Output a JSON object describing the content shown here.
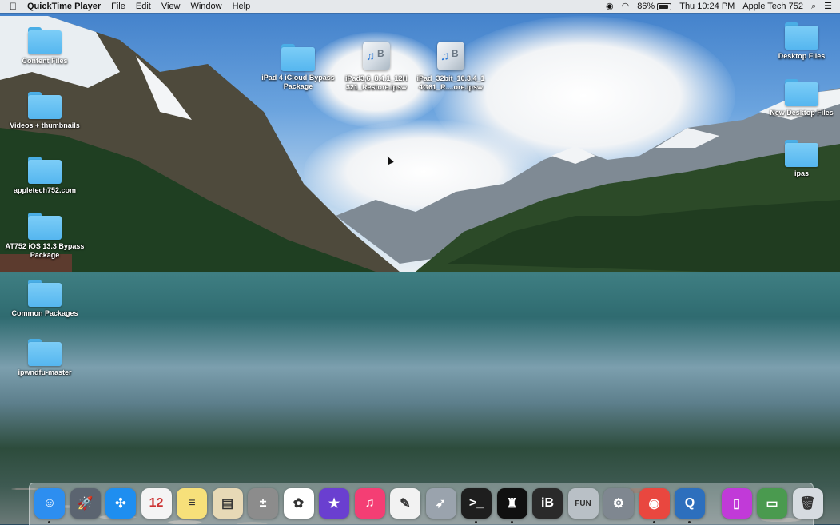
{
  "menubar": {
    "app_name": "QuickTime Player",
    "menus": [
      "File",
      "Edit",
      "View",
      "Window",
      "Help"
    ],
    "battery_percent_label": "86%",
    "battery_level": 0.86,
    "clock": "Thu 10:24 PM",
    "user": "Apple Tech 752",
    "icons": [
      "apple-icon",
      "screen-record-icon",
      "wifi-icon",
      "battery-charging-icon",
      "spotlight-icon",
      "notification-center-icon"
    ]
  },
  "desktop": {
    "left_icons": [
      "Content Files",
      "Videos + thumbnails",
      "appletech752.com",
      "AT752 iOS 13.3 Bypass Package",
      "Common Packages",
      "ipwndfu-master"
    ],
    "center_icons": [
      "iPad 4 iCloud Bypass Package",
      "iPad3,6_8.4.1_12H321_Restore.ipsw",
      "iPad_32bit_10.3.4_14G61_R....ore.ipsw"
    ],
    "right_icons": [
      "Desktop Files",
      "New Desktop Files",
      "ipas"
    ]
  },
  "dock": {
    "items": [
      {
        "name": "finder-icon",
        "glyph": "☺",
        "color": "#2d8ef0"
      },
      {
        "name": "launchpad-icon",
        "glyph": "🚀",
        "color": "#5b6470"
      },
      {
        "name": "safari-icon",
        "glyph": "✣",
        "color": "#1e8ef0"
      },
      {
        "name": "calendar-icon",
        "glyph": "12",
        "color": "#f4f4f4"
      },
      {
        "name": "notes-icon",
        "glyph": "≡",
        "color": "#f7e07a"
      },
      {
        "name": "preview-icon",
        "glyph": "▤",
        "color": "#e7d9b6"
      },
      {
        "name": "calculator-icon",
        "glyph": "±",
        "color": "#8c8c8c"
      },
      {
        "name": "photos-icon",
        "glyph": "✿",
        "color": "#ffffff"
      },
      {
        "name": "imovie-icon",
        "glyph": "★",
        "color": "#6a3fd0"
      },
      {
        "name": "itunes-icon",
        "glyph": "♫",
        "color": "#f43e74"
      },
      {
        "name": "textedit-icon",
        "glyph": "✎",
        "color": "#f2f2f2"
      },
      {
        "name": "rocket-app-icon",
        "glyph": "➶",
        "color": "#9aa3ad"
      },
      {
        "name": "terminal-icon",
        "glyph": ">_",
        "color": "#1e1e1e"
      },
      {
        "name": "chess-icon",
        "glyph": "♜",
        "color": "#101010"
      },
      {
        "name": "icloud-bypass-icon",
        "glyph": "iB",
        "color": "#2a2a2a"
      },
      {
        "name": "fun-icon",
        "glyph": "FUN",
        "color": "#b9c0c6"
      },
      {
        "name": "system-preferences-icon",
        "glyph": "⚙",
        "color": "#7f8790"
      },
      {
        "name": "chrome-icon",
        "glyph": "◉",
        "color": "#e9473f"
      },
      {
        "name": "quicktime-icon",
        "glyph": "Q",
        "color": "#2d6fbd"
      },
      {
        "name": "iphone-backup-icon",
        "glyph": "▯",
        "color": "#c13ad8"
      },
      {
        "name": "downloads-stack-icon",
        "glyph": "▭",
        "color": "#4a9a4f"
      },
      {
        "name": "trash-icon",
        "glyph": "🗑",
        "color": "#d6dbe0"
      }
    ]
  }
}
